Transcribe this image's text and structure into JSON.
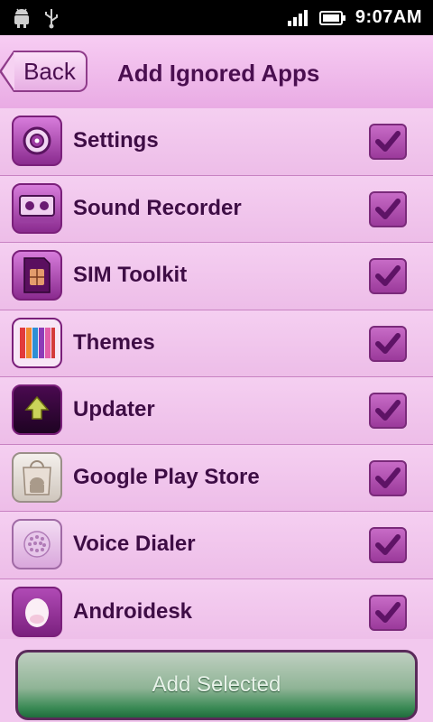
{
  "status_bar": {
    "time": "9:07AM",
    "left_icons": [
      "android-icon",
      "usb-icon"
    ],
    "right_icons": [
      "signal-icon",
      "battery-icon"
    ]
  },
  "header": {
    "back_label": "Back",
    "title": "Add Ignored Apps"
  },
  "apps": [
    {
      "name": "Settings",
      "icon": "settings-icon",
      "checked": true
    },
    {
      "name": "Sound Recorder",
      "icon": "sound-recorder-icon",
      "checked": true
    },
    {
      "name": "SIM Toolkit",
      "icon": "sim-toolkit-icon",
      "checked": true
    },
    {
      "name": "Themes",
      "icon": "themes-icon",
      "checked": true
    },
    {
      "name": "Updater",
      "icon": "updater-icon",
      "checked": true
    },
    {
      "name": "Google Play Store",
      "icon": "play-store-icon",
      "checked": true
    },
    {
      "name": "Voice Dialer",
      "icon": "voice-dialer-icon",
      "checked": true
    },
    {
      "name": "Androidesk",
      "icon": "androidesk-icon",
      "checked": true
    }
  ],
  "footer": {
    "add_selected_label": "Add Selected"
  },
  "colors": {
    "background": "#f2c6ee",
    "accent": "#8a2b8f",
    "button_green": "#3a8a55"
  }
}
